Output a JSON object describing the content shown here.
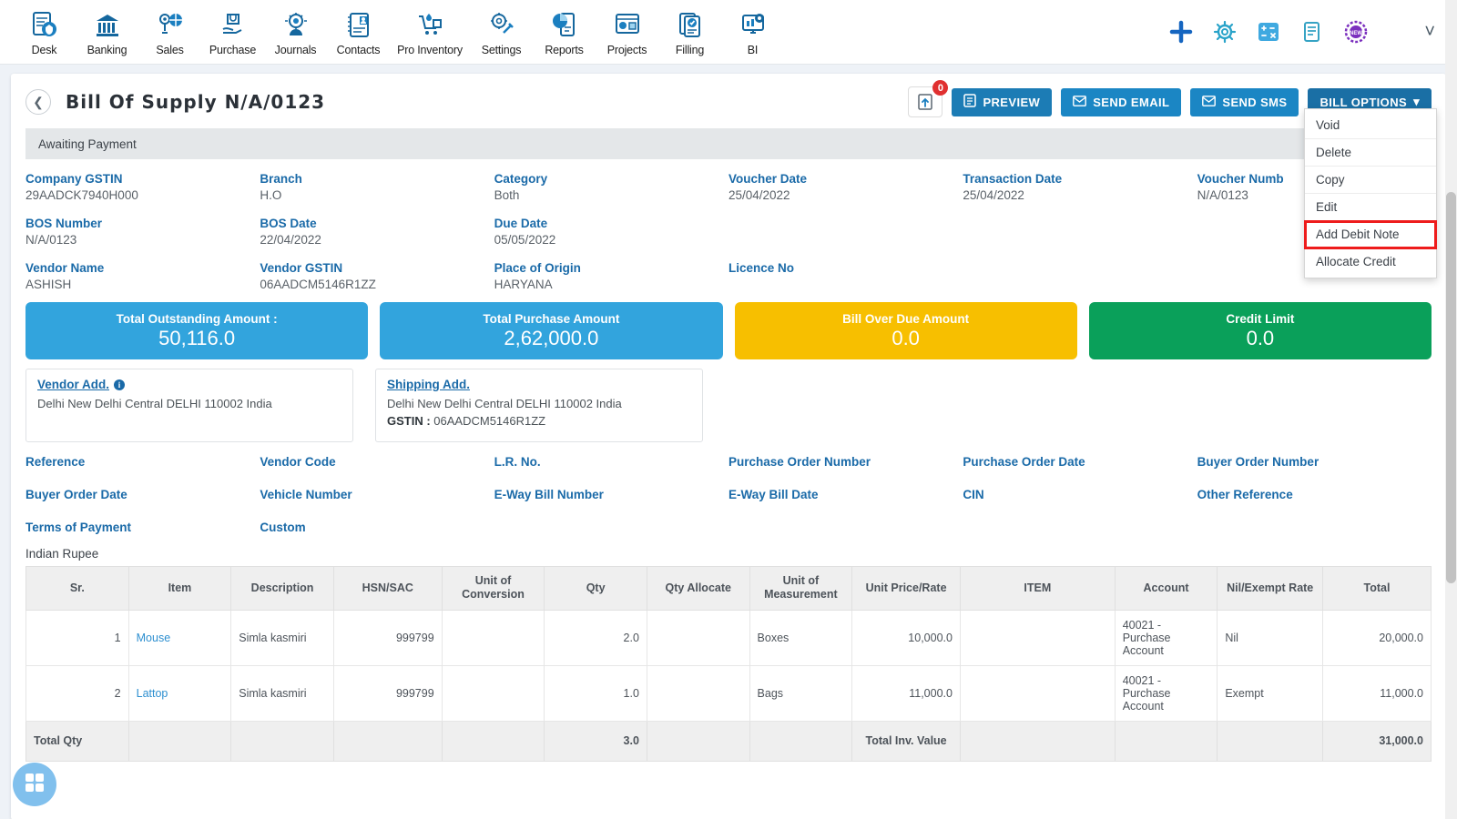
{
  "nav": {
    "items": [
      {
        "label": "Desk",
        "icon": "desk-dashboard-icon"
      },
      {
        "label": "Banking",
        "icon": "bank-building-icon"
      },
      {
        "label": "Sales",
        "icon": "sales-tag-icon"
      },
      {
        "label": "Purchase",
        "icon": "purchase-hand-icon"
      },
      {
        "label": "Journals",
        "icon": "journals-gear-icon"
      },
      {
        "label": "Contacts",
        "icon": "contacts-card-icon"
      },
      {
        "label": "Pro Inventory",
        "icon": "inventory-cart-icon"
      },
      {
        "label": "Settings",
        "icon": "settings-tools-icon"
      },
      {
        "label": "Reports",
        "icon": "reports-chart-icon"
      },
      {
        "label": "Projects",
        "icon": "projects-board-icon"
      },
      {
        "label": "Filling",
        "icon": "filling-doc-check-icon"
      },
      {
        "label": "BI",
        "icon": "bi-monitor-icon"
      }
    ],
    "right_icons": [
      {
        "name": "add-plus-icon",
        "color": "#1565c0"
      },
      {
        "name": "gear-icon",
        "color": "#29a3c9"
      },
      {
        "name": "calculator-icon",
        "color": "#3fa9e0"
      },
      {
        "name": "notes-icon",
        "color": "#36a3c4"
      },
      {
        "name": "new-badge-icon",
        "color": "#7b2fbe"
      }
    ],
    "chevron": "chevron-down-icon"
  },
  "header": {
    "back_icon": "back-chevron-icon",
    "title": "Bill Of Supply N/A/0123",
    "upload_icon": "upload-icon",
    "upload_badge": "0",
    "buttons": [
      {
        "label": "PREVIEW",
        "icon": "file-pdf-icon"
      },
      {
        "label": "SEND EMAIL",
        "icon": "envelope-icon"
      },
      {
        "label": "SEND SMS",
        "icon": "envelope-icon"
      },
      {
        "label": "BILL OPTIONS",
        "icon": "caret-down-icon"
      }
    ],
    "dropdown": {
      "items": [
        "Void",
        "Delete",
        "Copy",
        "Edit",
        "Add Debit Note",
        "Allocate Credit"
      ],
      "highlighted": "Add Debit Note",
      "highlight_color": "#ee1c1c"
    }
  },
  "status": {
    "text": "Awaiting Payment"
  },
  "details": [
    {
      "label": "Company GSTIN",
      "value": "29AADCK7940H000"
    },
    {
      "label": "Branch",
      "value": "H.O"
    },
    {
      "label": "Category",
      "value": "Both"
    },
    {
      "label": "Voucher Date",
      "value": "25/04/2022"
    },
    {
      "label": "Transaction Date",
      "value": "25/04/2022"
    },
    {
      "label": "Voucher Numb",
      "value": "N/A/0123"
    },
    {
      "label": "BOS Number",
      "value": "N/A/0123"
    },
    {
      "label": "BOS Date",
      "value": "22/04/2022"
    },
    {
      "label": "Due Date",
      "value": "05/05/2022"
    },
    {
      "label": "",
      "value": ""
    },
    {
      "label": "",
      "value": ""
    },
    {
      "label": "",
      "value": ""
    },
    {
      "label": "Vendor Name",
      "value": "ASHISH"
    },
    {
      "label": "Vendor GSTIN",
      "value": "06AADCM5146R1ZZ"
    },
    {
      "label": "Place of Origin",
      "value": "HARYANA"
    },
    {
      "label": "Licence No",
      "value": ""
    },
    {
      "label": "",
      "value": ""
    },
    {
      "label": "",
      "value": ""
    }
  ],
  "stats": [
    {
      "title": "Total Outstanding Amount :",
      "value": "50,116.0",
      "color": "#32a4dd"
    },
    {
      "title": "Total Purchase Amount",
      "value": "2,62,000.0",
      "color": "#32a4dd"
    },
    {
      "title": "Bill Over Due Amount",
      "value": "0.0",
      "color": "#f7bf00"
    },
    {
      "title": "Credit Limit",
      "value": "0.0",
      "color": "#0aa05a"
    }
  ],
  "addresses": {
    "vendor": {
      "title": "Vendor Add.",
      "info_icon": "info-icon",
      "line1": "Delhi New Delhi Central DELHI 110002 India"
    },
    "shipping": {
      "title": "Shipping Add.",
      "line1": "Delhi New Delhi Central DELHI 110002 India",
      "gstin_label": "GSTIN :",
      "gstin_value": "06AADCM5146R1ZZ"
    }
  },
  "references": [
    "Reference",
    "Vendor Code",
    "L.R. No.",
    "Purchase Order Number",
    "Purchase Order Date",
    "Buyer Order Number",
    "Buyer Order Date",
    "Vehicle Number",
    "E-Way Bill Number",
    "E-Way Bill Date",
    "CIN",
    "Other Reference",
    "Terms of Payment",
    "Custom",
    "",
    "",
    "",
    ""
  ],
  "table": {
    "currency": "Indian Rupee",
    "columns": [
      "Sr.",
      "Item",
      "Description",
      "HSN/SAC",
      "Unit of Conversion",
      "Qty",
      "Qty Allocate",
      "Unit of Measurement",
      "Unit Price/Rate",
      "ITEM",
      "Account",
      "Nil/Exempt Rate",
      "Total"
    ],
    "rows": [
      {
        "sr": "1",
        "item": "Mouse",
        "description": "Simla kasmiri",
        "hsn": "999799",
        "unit_conv": "",
        "qty": "2.0",
        "qty_alloc": "",
        "uom": "Boxes",
        "unit_price": "10,000.0",
        "item2": "",
        "account": "40021 - Purchase Account",
        "nil_exempt": "Nil",
        "total": "20,000.0"
      },
      {
        "sr": "2",
        "item": "Lattop",
        "description": "Simla kasmiri",
        "hsn": "999799",
        "unit_conv": "",
        "qty": "1.0",
        "qty_alloc": "",
        "uom": "Bags",
        "unit_price": "11,000.0",
        "item2": "",
        "account": "40021 - Purchase Account",
        "nil_exempt": "Exempt",
        "total": "11,000.0"
      }
    ],
    "footer": {
      "total_qty_label": "Total Qty",
      "total_qty_value": "3.0",
      "total_inv_label": "Total Inv. Value",
      "total_inv_value": "31,000.0"
    }
  },
  "fab": {
    "icon": "grid-apps-icon"
  }
}
